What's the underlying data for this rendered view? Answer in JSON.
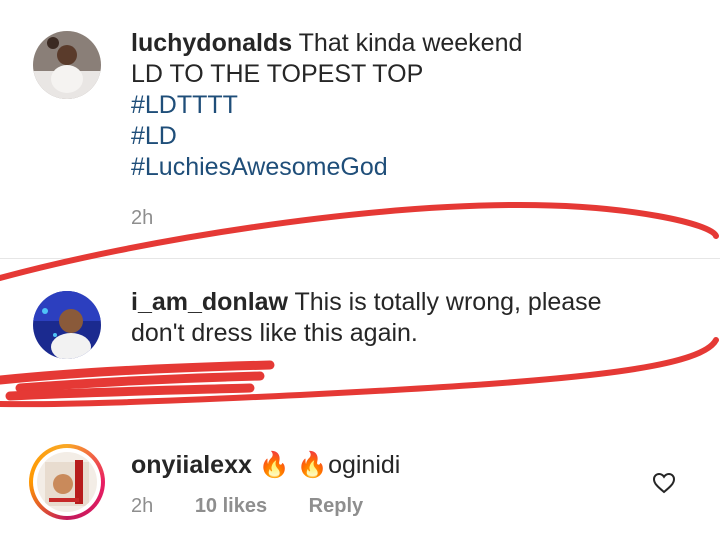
{
  "comments": [
    {
      "username": "luchydonalds",
      "lines": [
        "That kinda weekend",
        "LD TO THE TOPEST TOP"
      ],
      "hashtags": [
        "#LDTTTT",
        "#LD",
        "#LuchiesAwesomeGod"
      ],
      "time": "2h"
    },
    {
      "username": "i_am_donlaw",
      "text_line1": "This is totally wrong, please",
      "text_line2": "don't dress like this again."
    },
    {
      "username": "onyiialexx",
      "emoji": "🔥 🔥",
      "text": "oginidi",
      "time": "2h",
      "likes": "10 likes",
      "reply": "Reply"
    }
  ],
  "annotation_color": "#e53935",
  "icons": {
    "fire": "fire-emoji",
    "like": "heart-outline-icon"
  }
}
